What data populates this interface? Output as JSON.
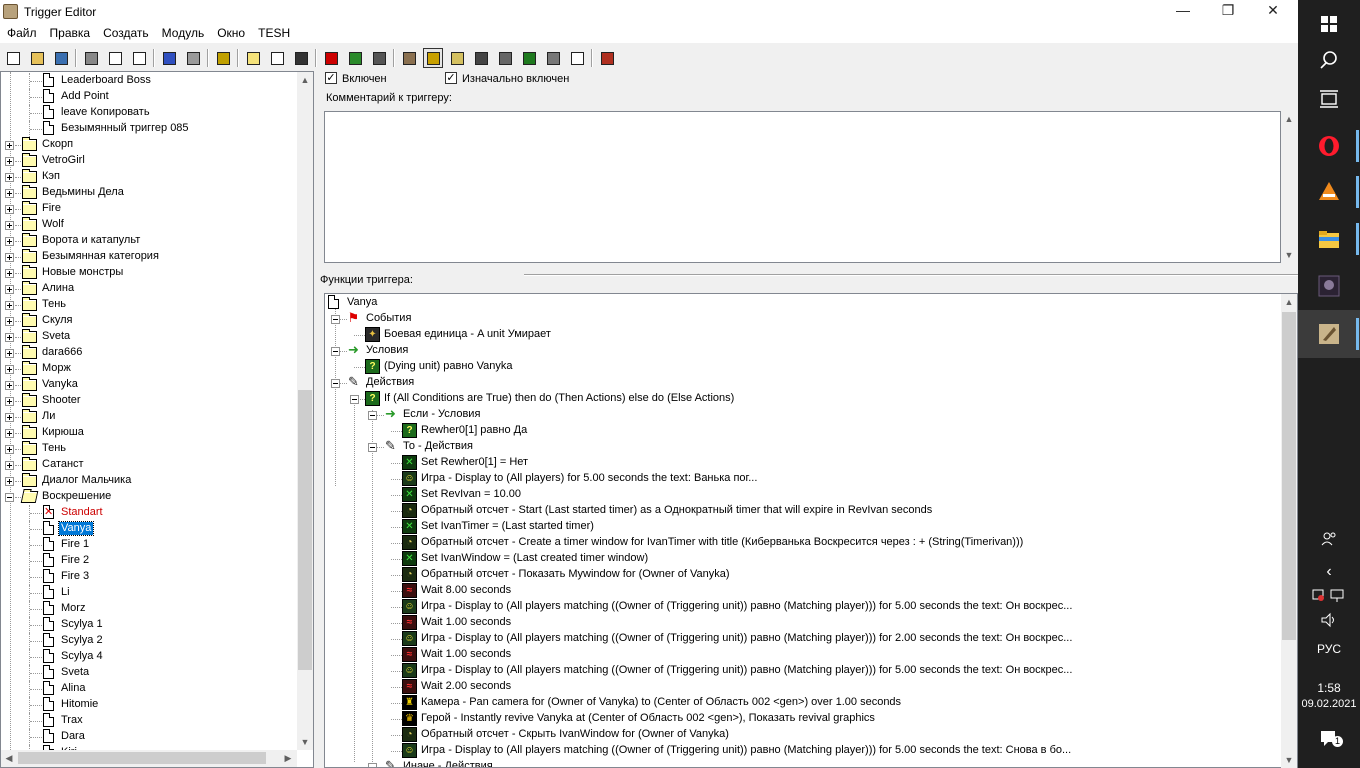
{
  "window": {
    "title": "Trigger Editor",
    "minimize": "—",
    "maximize": "❐",
    "close": "✕"
  },
  "menu": [
    "Файл",
    "Правка",
    "Создать",
    "Модуль",
    "Окно",
    "TESH"
  ],
  "toolbar_icons": [
    "new-icon",
    "open-icon",
    "save-icon",
    "cut-icon",
    "copy-icon",
    "paste-icon",
    "undo-icon",
    "redo-icon",
    "delete-icon",
    "new-category-icon",
    "new-trigger-icon",
    "new-comment-icon",
    "new-event-icon",
    "new-condition-icon",
    "new-action-icon",
    "terrain-editor-icon",
    "trigger-editor-icon",
    "sound-editor-icon",
    "object-editor-icon",
    "campaign-editor-icon",
    "ai-editor-icon",
    "object-manager-icon",
    "import-manager-icon",
    "test-map-icon"
  ],
  "tree": {
    "items": [
      {
        "label": "Leaderboard  Boss",
        "type": "trigger",
        "level": 2
      },
      {
        "label": "Add Point",
        "type": "trigger",
        "level": 2
      },
      {
        "label": "leave Копировать",
        "type": "trigger",
        "level": 2
      },
      {
        "label": "Безымянный триггер 085",
        "type": "trigger",
        "level": 2
      },
      {
        "label": "Скорп",
        "type": "folder",
        "level": 1
      },
      {
        "label": "VetroGirl",
        "type": "folder",
        "level": 1
      },
      {
        "label": "Кэп",
        "type": "folder",
        "level": 1
      },
      {
        "label": "Ведьмины Дела",
        "type": "folder",
        "level": 1
      },
      {
        "label": "Fire",
        "type": "folder",
        "level": 1
      },
      {
        "label": "Wolf",
        "type": "folder",
        "level": 1
      },
      {
        "label": "Ворота и катапульт",
        "type": "folder",
        "level": 1
      },
      {
        "label": "Безымянная категория",
        "type": "folder",
        "level": 1
      },
      {
        "label": "Новые монстры",
        "type": "folder",
        "level": 1
      },
      {
        "label": "Алина",
        "type": "folder",
        "level": 1
      },
      {
        "label": "Тень",
        "type": "folder",
        "level": 1
      },
      {
        "label": "Скуля",
        "type": "folder",
        "level": 1
      },
      {
        "label": "Sveta",
        "type": "folder",
        "level": 1
      },
      {
        "label": "dara666",
        "type": "folder",
        "level": 1
      },
      {
        "label": "Морж",
        "type": "folder",
        "level": 1
      },
      {
        "label": "Vanyka",
        "type": "folder",
        "level": 1
      },
      {
        "label": "Shooter",
        "type": "folder",
        "level": 1
      },
      {
        "label": "Ли",
        "type": "folder",
        "level": 1
      },
      {
        "label": "Кирюша",
        "type": "folder",
        "level": 1
      },
      {
        "label": "Тень",
        "type": "folder",
        "level": 1
      },
      {
        "label": "Сатанст",
        "type": "folder",
        "level": 1
      },
      {
        "label": "Диалог Мальчика",
        "type": "folder",
        "level": 1
      },
      {
        "label": "Воскрешение",
        "type": "folder-open",
        "level": 1
      },
      {
        "label": "Standart",
        "type": "trigger-disabled",
        "level": 2
      },
      {
        "label": "Vanya",
        "type": "trigger-selected",
        "level": 2
      },
      {
        "label": "Fire 1",
        "type": "trigger",
        "level": 2
      },
      {
        "label": "Fire 2",
        "type": "trigger",
        "level": 2
      },
      {
        "label": "Fire 3",
        "type": "trigger",
        "level": 2
      },
      {
        "label": "Li",
        "type": "trigger",
        "level": 2
      },
      {
        "label": "Morz",
        "type": "trigger",
        "level": 2
      },
      {
        "label": "Scylya 1",
        "type": "trigger",
        "level": 2
      },
      {
        "label": "Scylya 2",
        "type": "trigger",
        "level": 2
      },
      {
        "label": "Scylya 4",
        "type": "trigger",
        "level": 2
      },
      {
        "label": "Sveta",
        "type": "trigger",
        "level": 2
      },
      {
        "label": "Alina",
        "type": "trigger",
        "level": 2
      },
      {
        "label": "Hitomie",
        "type": "trigger",
        "level": 2
      },
      {
        "label": "Trax",
        "type": "trigger",
        "level": 2
      },
      {
        "label": "Dara",
        "type": "trigger",
        "level": 2
      },
      {
        "label": "Kiri",
        "type": "trigger",
        "level": 2
      }
    ]
  },
  "trigger": {
    "enabled_label": "Включен",
    "enabled": true,
    "initially_on_label": "Изначально включен",
    "initially_on": true,
    "comment_label": "Комментарий к триггеру:",
    "comment_value": "",
    "functions_label": "Функции триггера:"
  },
  "functions": [
    {
      "text": "Vanya",
      "icon": "trigger",
      "level": 0
    },
    {
      "text": "События",
      "icon": "event",
      "level": 1,
      "toggle": "minus"
    },
    {
      "text": "Боевая единица - A unit Умирает",
      "icon": "unit-event",
      "level": 2
    },
    {
      "text": "Условия",
      "icon": "conditions",
      "level": 1,
      "toggle": "minus"
    },
    {
      "text": "(Dying unit) равно Vanyka",
      "icon": "condition",
      "level": 2
    },
    {
      "text": "Действия",
      "icon": "actions",
      "level": 1,
      "toggle": "minus"
    },
    {
      "text": "If (All Conditions are True) then do (Then Actions) else do (Else Actions)",
      "icon": "condition",
      "level": 2,
      "toggle": "minus"
    },
    {
      "text": "Если - Условия",
      "icon": "conditions",
      "level": 3,
      "toggle": "minus"
    },
    {
      "text": "Rewher0[1] равно Да",
      "icon": "condition",
      "level": 4
    },
    {
      "text": "То - Действия",
      "icon": "actions",
      "level": 3,
      "toggle": "minus"
    },
    {
      "text": "Set Rewher0[1] = Нет",
      "icon": "set-var",
      "level": 4
    },
    {
      "text": "Игра - Display to (All players) for 5.00 seconds the text: Ванька пог...",
      "icon": "game",
      "level": 4
    },
    {
      "text": "Set RevIvan = 10.00",
      "icon": "set-var",
      "level": 4
    },
    {
      "text": "Обратный отсчет - Start (Last started timer) as a Однократный timer that will expire in RevIvan seconds",
      "icon": "timer",
      "level": 4
    },
    {
      "text": "Set IvanTimer = (Last started timer)",
      "icon": "set-var",
      "level": 4
    },
    {
      "text": "Обратный отсчет - Create a timer window for IvanTimer with title (Киберванька Воскресится через  : + (String(Timerivan)))",
      "icon": "timer",
      "level": 4
    },
    {
      "text": "Set IvanWindow = (Last created timer window)",
      "icon": "set-var",
      "level": 4
    },
    {
      "text": "Обратный отсчет - Показать Mywindow for (Owner of Vanyka)",
      "icon": "timer",
      "level": 4
    },
    {
      "text": "Wait 8.00 seconds",
      "icon": "wait",
      "level": 4
    },
    {
      "text": "Игра - Display to (All players matching ((Owner of (Triggering unit)) равно (Matching player))) for 5.00 seconds the text: Он воскрес...",
      "icon": "game",
      "level": 4
    },
    {
      "text": "Wait 1.00 seconds",
      "icon": "wait",
      "level": 4
    },
    {
      "text": "Игра - Display to (All players matching ((Owner of (Triggering unit)) равно (Matching player))) for 2.00 seconds the text: Он воскрес...",
      "icon": "game",
      "level": 4
    },
    {
      "text": "Wait 1.00 seconds",
      "icon": "wait",
      "level": 4
    },
    {
      "text": "Игра - Display to (All players matching ((Owner of (Triggering unit)) равно (Matching player))) for 5.00 seconds the text: Он воскрес...",
      "icon": "game",
      "level": 4
    },
    {
      "text": "Wait 2.00 seconds",
      "icon": "wait",
      "level": 4
    },
    {
      "text": "Камера - Pan camera for (Owner of Vanyka) to (Center of Область 002 <gen>) over 1.00 seconds",
      "icon": "camera",
      "level": 4
    },
    {
      "text": "Герой - Instantly revive Vanyka at (Center of Область 002 <gen>), Показать revival graphics",
      "icon": "hero",
      "level": 4
    },
    {
      "text": "Обратный отсчет - Скрыть IvanWindow for (Owner of Vanyka)",
      "icon": "timer",
      "level": 4
    },
    {
      "text": "Игра - Display to (All players matching ((Owner of (Triggering unit)) равно (Matching player))) for 5.00 seconds the text: Снова в бо...",
      "icon": "game",
      "level": 4
    },
    {
      "text": "Иначе - Действия",
      "icon": "actions",
      "level": 3,
      "toggle": "minus"
    }
  ],
  "taskbar": {
    "icons": [
      "windows-start-icon",
      "search-icon",
      "task-view-icon",
      "opera-icon",
      "vlc-icon",
      "file-explorer-icon",
      "game-icon",
      "world-editor-icon"
    ],
    "language": "РУС",
    "time": "1:58",
    "date": "09.02.2021",
    "notification_count": "1"
  },
  "colors": {
    "selection": "#0078d7",
    "disabled": "#cc0000",
    "taskbar": "#1f1f1f",
    "accent": "#76b9ed"
  }
}
